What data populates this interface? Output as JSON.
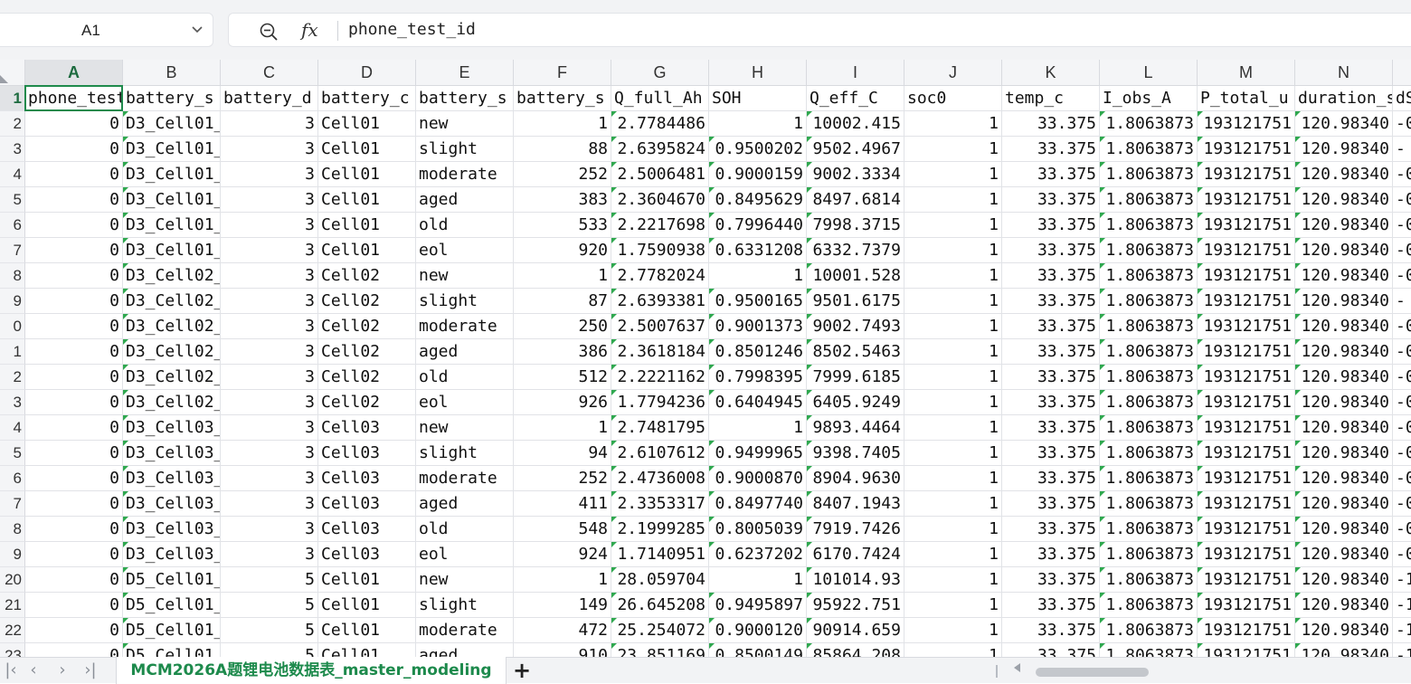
{
  "name_box": {
    "value": "A1"
  },
  "formula_bar": {
    "content": "phone_test_id"
  },
  "icons": {
    "name_box_dropdown": "chevron-down-icon",
    "zoom": "zoom-search-icon",
    "function": "fx-icon"
  },
  "colors": {
    "accent": "#1f8a4c",
    "sheet_tab_text": "#1d8a4c",
    "header_bg": "#f4f5f7",
    "flag": "#2fa84f"
  },
  "grid": {
    "columns": [
      "A",
      "B",
      "C",
      "D",
      "E",
      "F",
      "G",
      "H",
      "I",
      "J",
      "K",
      "L",
      "M",
      "N"
    ],
    "column_widths": [
      108,
      108,
      108,
      108,
      108,
      108,
      108,
      108,
      108,
      108,
      108,
      108,
      108,
      108
    ],
    "row_numbers": [
      "1",
      "2",
      "3",
      "4",
      "5",
      "6",
      "7",
      "8",
      "9",
      "0",
      "1",
      "2",
      "3",
      "4",
      "5",
      "6",
      "7",
      "8",
      "9",
      "20",
      "21",
      "22",
      "23"
    ],
    "header_row": [
      "phone_test_id",
      "battery_s",
      "battery_d",
      "battery_c",
      "battery_s",
      "battery_s",
      "Q_full_Ah",
      "SOH",
      "Q_eff_C",
      "soc0",
      "temp_c",
      "I_obs_A",
      "P_total_u",
      "duration_s",
      "dS"
    ],
    "rows": [
      [
        "0",
        "D3_Cell01_",
        "3",
        "Cell01",
        "new",
        "1",
        "2.7784486",
        "1",
        "10002.415",
        "1",
        "33.375",
        "1.8063873",
        "193121751",
        "120.98340",
        "-0"
      ],
      [
        "0",
        "D3_Cell01_",
        "3",
        "Cell01",
        "slight",
        "88",
        "2.6395824",
        "0.9500202",
        "9502.4967",
        "1",
        "33.375",
        "1.8063873",
        "193121751",
        "120.98340",
        "-"
      ],
      [
        "0",
        "D3_Cell01_",
        "3",
        "Cell01",
        "moderate",
        "252",
        "2.5006481",
        "0.9000159",
        "9002.3334",
        "1",
        "33.375",
        "1.8063873",
        "193121751",
        "120.98340",
        "-0"
      ],
      [
        "0",
        "D3_Cell01_",
        "3",
        "Cell01",
        "aged",
        "383",
        "2.3604670",
        "0.8495629",
        "8497.6814",
        "1",
        "33.375",
        "1.8063873",
        "193121751",
        "120.98340",
        "-0"
      ],
      [
        "0",
        "D3_Cell01_",
        "3",
        "Cell01",
        "old",
        "533",
        "2.2217698",
        "0.7996440",
        "7998.3715",
        "1",
        "33.375",
        "1.8063873",
        "193121751",
        "120.98340",
        "-0"
      ],
      [
        "0",
        "D3_Cell01_",
        "3",
        "Cell01",
        "eol",
        "920",
        "1.7590938",
        "0.6331208",
        "6332.7379",
        "1",
        "33.375",
        "1.8063873",
        "193121751",
        "120.98340",
        "-0"
      ],
      [
        "0",
        "D3_Cell02_",
        "3",
        "Cell02",
        "new",
        "1",
        "2.7782024",
        "1",
        "10001.528",
        "1",
        "33.375",
        "1.8063873",
        "193121751",
        "120.98340",
        "-0"
      ],
      [
        "0",
        "D3_Cell02_",
        "3",
        "Cell02",
        "slight",
        "87",
        "2.6393381",
        "0.9500165",
        "9501.6175",
        "1",
        "33.375",
        "1.8063873",
        "193121751",
        "120.98340",
        "-"
      ],
      [
        "0",
        "D3_Cell02_",
        "3",
        "Cell02",
        "moderate",
        "250",
        "2.5007637",
        "0.9001373",
        "9002.7493",
        "1",
        "33.375",
        "1.8063873",
        "193121751",
        "120.98340",
        "-0"
      ],
      [
        "0",
        "D3_Cell02_",
        "3",
        "Cell02",
        "aged",
        "386",
        "2.3618184",
        "0.8501246",
        "8502.5463",
        "1",
        "33.375",
        "1.8063873",
        "193121751",
        "120.98340",
        "-0"
      ],
      [
        "0",
        "D3_Cell02_",
        "3",
        "Cell02",
        "old",
        "512",
        "2.2221162",
        "0.7998395",
        "7999.6185",
        "1",
        "33.375",
        "1.8063873",
        "193121751",
        "120.98340",
        "-0"
      ],
      [
        "0",
        "D3_Cell02_",
        "3",
        "Cell02",
        "eol",
        "926",
        "1.7794236",
        "0.6404945",
        "6405.9249",
        "1",
        "33.375",
        "1.8063873",
        "193121751",
        "120.98340",
        "-0"
      ],
      [
        "0",
        "D3_Cell03_",
        "3",
        "Cell03",
        "new",
        "1",
        "2.7481795",
        "1",
        "9893.4464",
        "1",
        "33.375",
        "1.8063873",
        "193121751",
        "120.98340",
        "-0"
      ],
      [
        "0",
        "D3_Cell03_",
        "3",
        "Cell03",
        "slight",
        "94",
        "2.6107612",
        "0.9499965",
        "9398.7405",
        "1",
        "33.375",
        "1.8063873",
        "193121751",
        "120.98340",
        "-0"
      ],
      [
        "0",
        "D3_Cell03_",
        "3",
        "Cell03",
        "moderate",
        "252",
        "2.4736008",
        "0.9000870",
        "8904.9630",
        "1",
        "33.375",
        "1.8063873",
        "193121751",
        "120.98340",
        "-0"
      ],
      [
        "0",
        "D3_Cell03_",
        "3",
        "Cell03",
        "aged",
        "411",
        "2.3353317",
        "0.8497740",
        "8407.1943",
        "1",
        "33.375",
        "1.8063873",
        "193121751",
        "120.98340",
        "-0"
      ],
      [
        "0",
        "D3_Cell03_",
        "3",
        "Cell03",
        "old",
        "548",
        "2.1999285",
        "0.8005039",
        "7919.7426",
        "1",
        "33.375",
        "1.8063873",
        "193121751",
        "120.98340",
        "-0"
      ],
      [
        "0",
        "D3_Cell03_",
        "3",
        "Cell03",
        "eol",
        "924",
        "1.7140951",
        "0.6237202",
        "6170.7424",
        "1",
        "33.375",
        "1.8063873",
        "193121751",
        "120.98340",
        "-0"
      ],
      [
        "0",
        "D5_Cell01_",
        "5",
        "Cell01",
        "new",
        "1",
        "28.059704",
        "1",
        "101014.93",
        "1",
        "33.375",
        "1.8063873",
        "193121751",
        "120.98340",
        "-1"
      ],
      [
        "0",
        "D5_Cell01_",
        "5",
        "Cell01",
        "slight",
        "149",
        "26.645208",
        "0.9495897",
        "95922.751",
        "1",
        "33.375",
        "1.8063873",
        "193121751",
        "120.98340",
        "-1"
      ],
      [
        "0",
        "D5_Cell01_",
        "5",
        "Cell01",
        "moderate",
        "472",
        "25.254072",
        "0.9000120",
        "90914.659",
        "1",
        "33.375",
        "1.8063873",
        "193121751",
        "120.98340",
        "-1"
      ],
      [
        "0",
        "D5_Cell01_",
        "5",
        "Cell01",
        "aged",
        "910",
        "23.851169",
        "0.8500149",
        "85864.208",
        "1",
        "33.375",
        "1.8063873",
        "193121751",
        "120.98340",
        "-1"
      ]
    ]
  },
  "sheet_tabs": {
    "active": "MCM2026A题锂电池数据表_master_modeling",
    "add_label": "+"
  },
  "navigation": {
    "first": "|‹",
    "prev": "‹",
    "next": "›",
    "last": "›|"
  }
}
